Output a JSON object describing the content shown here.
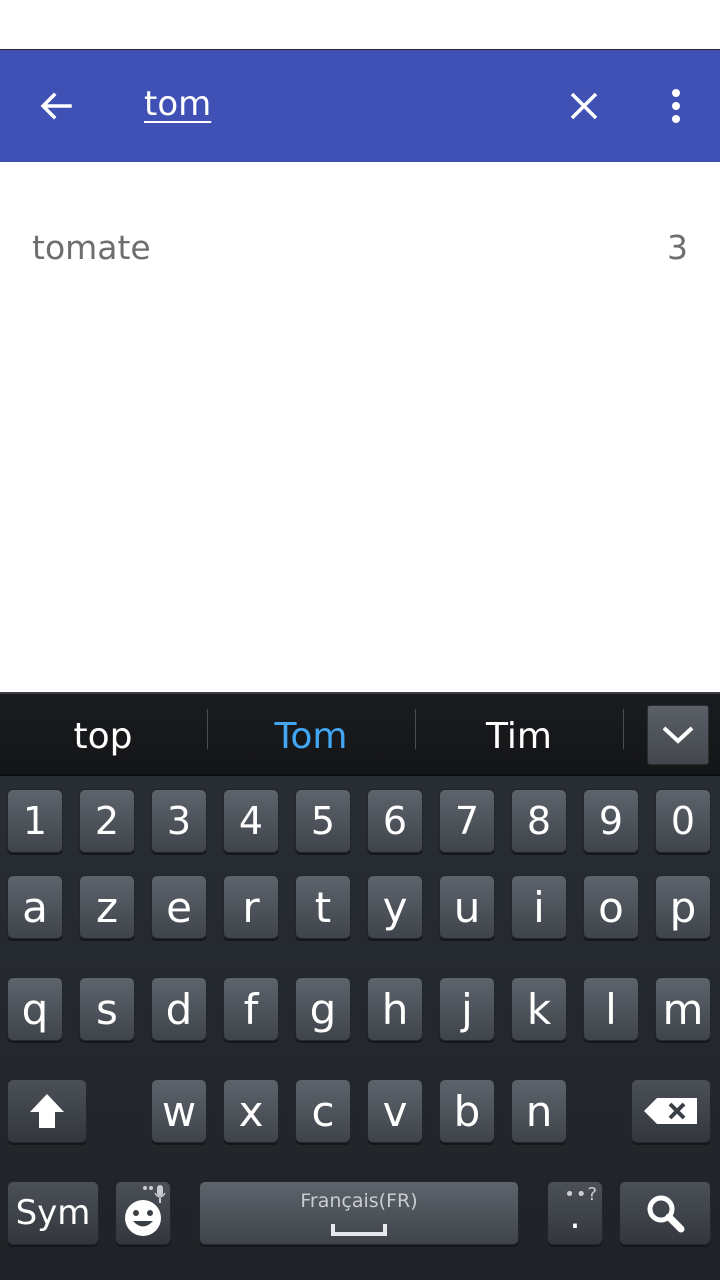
{
  "toolbar": {
    "query": "tom",
    "bg_color": "#3f51b5"
  },
  "results": [
    {
      "name": "tomate",
      "count": "3"
    }
  ],
  "keyboard": {
    "suggestions": [
      "top",
      "Tom",
      "Tim"
    ],
    "active_suggestion_color": "#43a6f2",
    "row_numbers": [
      "1",
      "2",
      "3",
      "4",
      "5",
      "6",
      "7",
      "8",
      "9",
      "0"
    ],
    "row1": [
      "a",
      "z",
      "e",
      "r",
      "t",
      "y",
      "u",
      "i",
      "o",
      "p"
    ],
    "row2": [
      "q",
      "s",
      "d",
      "f",
      "g",
      "h",
      "j",
      "k",
      "l",
      "m"
    ],
    "row3": [
      "w",
      "x",
      "c",
      "v",
      "b",
      "n"
    ],
    "sym_label": "Sym",
    "space_label": "Français(FR)",
    "period_label": ".",
    "period_hint": "••?"
  },
  "icons": {
    "back": "arrow-back-icon",
    "clear": "close-icon",
    "more": "more-vert-icon",
    "collapse": "chevron-down-icon",
    "shift": "shift-arrow-icon",
    "backspace": "backspace-icon",
    "emoji": "emoji-face-icon",
    "mic": "mic-icon",
    "search": "search-icon"
  }
}
